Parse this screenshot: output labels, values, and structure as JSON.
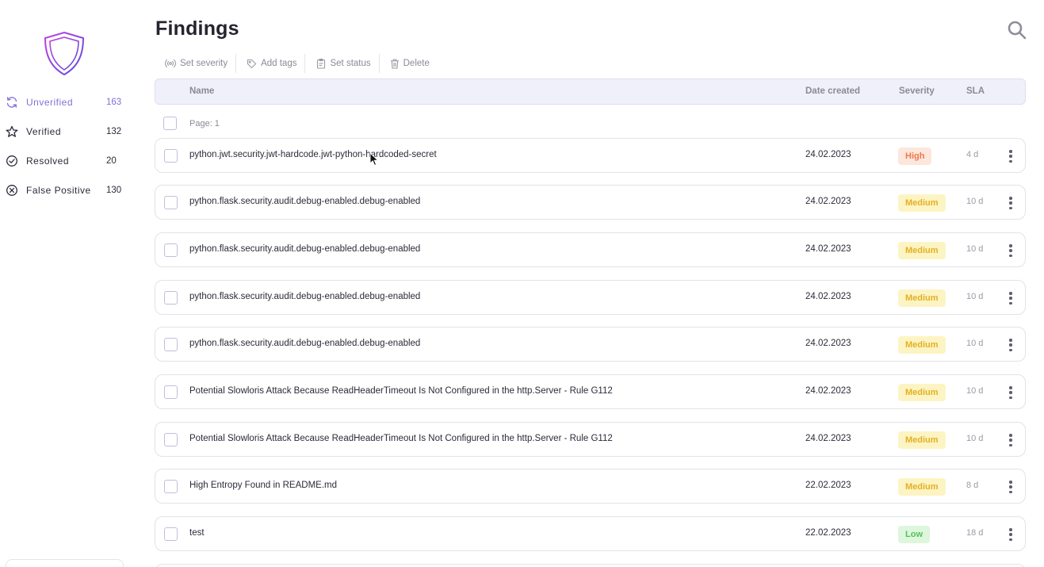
{
  "sidebar": {
    "logo": "shield-logo",
    "items": [
      {
        "label": "Unverified",
        "count": "163",
        "icon": "refresh-icon",
        "active": true
      },
      {
        "label": "Verified",
        "count": "132",
        "icon": "star-icon",
        "active": false
      },
      {
        "label": "Resolved",
        "count": "20",
        "icon": "check-circle-icon",
        "active": false
      },
      {
        "label": "False Positive",
        "count": "130",
        "icon": "x-circle-icon",
        "active": false
      }
    ]
  },
  "header": {
    "title": "Findings",
    "search_icon": "search-icon"
  },
  "toolbar": {
    "set_severity": "Set severity",
    "add_tags": "Add tags",
    "set_status": "Set status",
    "delete": "Delete"
  },
  "table": {
    "columns": {
      "name": "Name",
      "date": "Date created",
      "severity": "Severity",
      "sla": "SLA"
    },
    "page_label": "Page: 1",
    "rows": [
      {
        "name": "python.jwt.security.jwt-hardcode.jwt-python-hardcoded-secret",
        "date": "24.02.2023",
        "severity": "High",
        "sla": "4 d"
      },
      {
        "name": "python.flask.security.audit.debug-enabled.debug-enabled",
        "date": "24.02.2023",
        "severity": "Medium",
        "sla": "10 d"
      },
      {
        "name": "python.flask.security.audit.debug-enabled.debug-enabled",
        "date": "24.02.2023",
        "severity": "Medium",
        "sla": "10 d"
      },
      {
        "name": "python.flask.security.audit.debug-enabled.debug-enabled",
        "date": "24.02.2023",
        "severity": "Medium",
        "sla": "10 d"
      },
      {
        "name": "python.flask.security.audit.debug-enabled.debug-enabled",
        "date": "24.02.2023",
        "severity": "Medium",
        "sla": "10 d"
      },
      {
        "name": "Potential Slowloris Attack Because ReadHeaderTimeout Is Not Configured in the http.Server - Rule G112",
        "date": "24.02.2023",
        "severity": "Medium",
        "sla": "10 d"
      },
      {
        "name": "Potential Slowloris Attack Because ReadHeaderTimeout Is Not Configured in the http.Server - Rule G112",
        "date": "24.02.2023",
        "severity": "Medium",
        "sla": "10 d"
      },
      {
        "name": "High Entropy Found in README.md",
        "date": "22.02.2023",
        "severity": "Medium",
        "sla": "8 d"
      },
      {
        "name": "test",
        "date": "22.02.2023",
        "severity": "Low",
        "sla": "18 d"
      }
    ]
  },
  "colors": {
    "accent": "#7d72d9",
    "high_bg": "#fde6dc",
    "high_fg": "#ec7a4f",
    "medium_bg": "#fdf4c4",
    "medium_fg": "#e3b021",
    "low_bg": "#ddf6dc",
    "low_fg": "#55c25a"
  }
}
